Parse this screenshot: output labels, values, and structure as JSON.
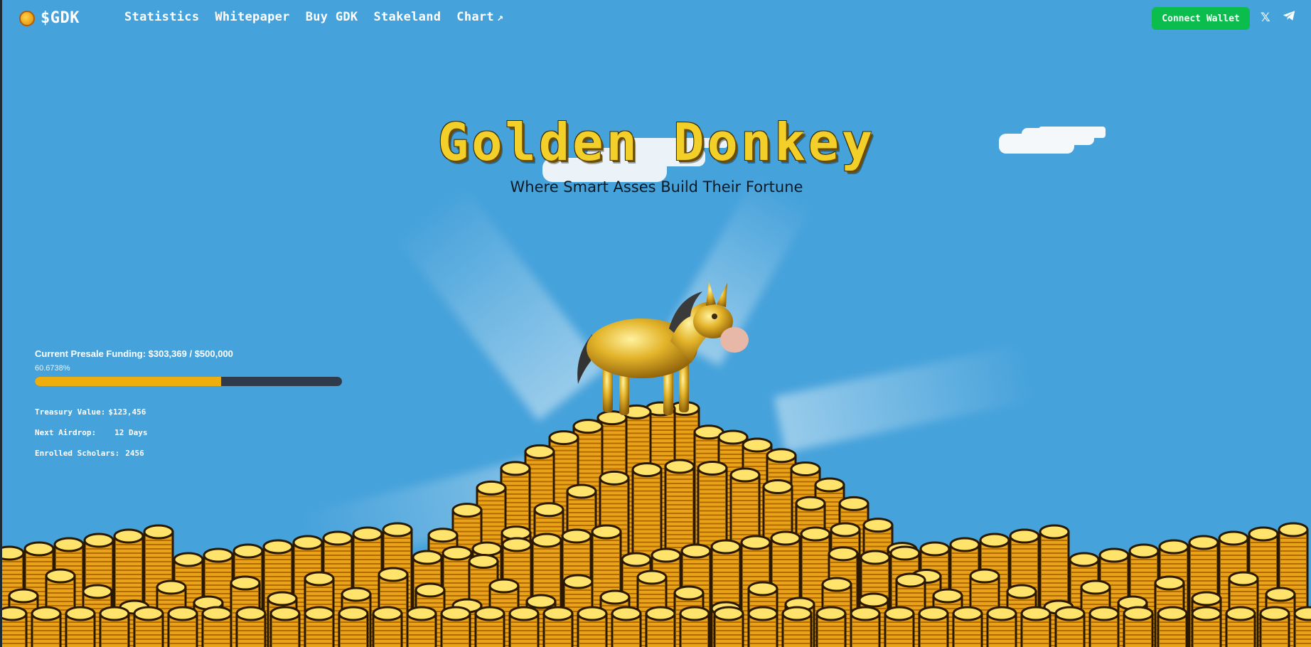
{
  "nav": {
    "brand": "$GDK",
    "items": [
      {
        "label": "Statistics"
      },
      {
        "label": "Whitepaper"
      },
      {
        "label": "Buy GDK"
      },
      {
        "label": "Stakeland"
      },
      {
        "label": "Chart"
      }
    ],
    "chart_arrow_icon": "external-arrow-icon",
    "connect_label": "Connect Wallet",
    "social_icons": [
      "x-icon",
      "telegram-icon"
    ]
  },
  "hero": {
    "title": "Golden Donkey",
    "subtitle": "Where Smart Asses Build Their Fortune"
  },
  "presale": {
    "label": "Current Presale Funding: $303,369 / $500,000",
    "percent_text": "60.6738%",
    "progress_fraction": 0.606738
  },
  "stats": [
    {
      "label": "Treasury Value:",
      "value": "$123,456"
    },
    {
      "label": "Next Airdrop:",
      "value": "12 Days"
    },
    {
      "label": "Enrolled Scholars:",
      "value": "2456"
    }
  ],
  "colors": {
    "background": "#46a2db",
    "title_gold": "#f3cf2a",
    "connect_button": "#0bbd4c",
    "progress_fill": "#eeae0d",
    "progress_track": "#2e3b4b"
  }
}
